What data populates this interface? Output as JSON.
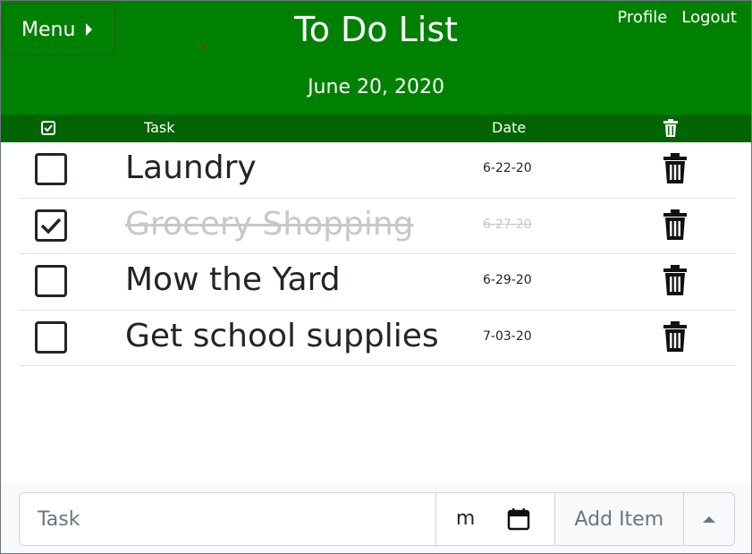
{
  "header": {
    "menu_label": "Menu",
    "title": "To Do List",
    "date": "June 20, 2020",
    "links": [
      "Profile",
      "Logout"
    ]
  },
  "columns": {
    "task": "Task",
    "date": "Date"
  },
  "tasks": [
    {
      "label": "Laundry",
      "date": "6-22-20",
      "done": false
    },
    {
      "label": "Grocery Shopping",
      "date": "6-27-20",
      "done": true
    },
    {
      "label": "Mow the Yard",
      "date": "6-29-20",
      "done": false
    },
    {
      "label": "Get school supplies",
      "date": "7-03-20",
      "done": false
    }
  ],
  "footer": {
    "task_placeholder": "Task",
    "date_value": "m",
    "add_label": "Add Item"
  },
  "colors": {
    "header_green": "#008000",
    "column_header_green": "#006400"
  },
  "icons": [
    "caret-right-icon",
    "checkbox-icon",
    "trash-icon",
    "calendar-icon",
    "caret-up-icon"
  ]
}
